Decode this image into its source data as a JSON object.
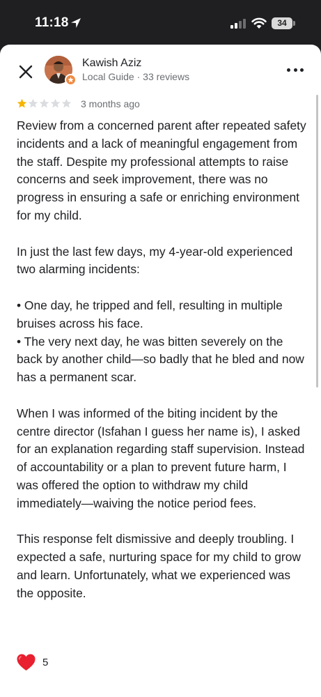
{
  "status_bar": {
    "time": "11:18",
    "battery_level": "34",
    "icons": [
      "location-arrow-icon",
      "cellular-signal-icon",
      "wifi-icon",
      "battery-icon"
    ]
  },
  "header": {
    "close_icon": "close-icon",
    "reviewer_name": "Kawish Aziz",
    "reviewer_meta": "Local Guide · 33 reviews",
    "badge_icon": "local-guide-star-icon",
    "more_icon": "more-options-icon"
  },
  "review": {
    "rating": 1,
    "rating_max": 5,
    "star_color": "#f6b400",
    "empty_star_color": "#dadce0",
    "date": "3 months ago",
    "paragraphs": [
      "Review from a concerned parent after repeated safety incidents and a lack of meaningful engagement from the staff. Despite my professional attempts to raise concerns and seek improvement, there was no progress in ensuring a safe or enriching environment for my child.",
      "In just the last few days, my 4-year-old experienced two alarming incidents:",
      "• One day, he tripped and fell, resulting in multiple bruises across his face.\n• The very next day, he was bitten severely on the back by another child—so badly that he bled and now has a permanent scar.",
      "When I was informed of the biting incident by the centre director (Isfahan I guess her name is), I asked for an explanation regarding staff supervision. Instead of accountability or a plan to prevent future harm, I was offered the option to withdraw my child immediately—waiving the notice period fees.",
      "This response felt dismissive and deeply troubling. I expected a safe, nurturing space for my child to grow and learn. Unfortunately, what we experienced was the opposite."
    ]
  },
  "reactions": {
    "icon": "heart-icon",
    "count": "5",
    "color": "#e8202f"
  },
  "colors": {
    "status_bar_bg": "#1f1f21",
    "sheet_bg": "#ffffff",
    "text_primary": "#202124",
    "text_secondary": "#6b6e72",
    "badge_orange": "#f08a42"
  }
}
